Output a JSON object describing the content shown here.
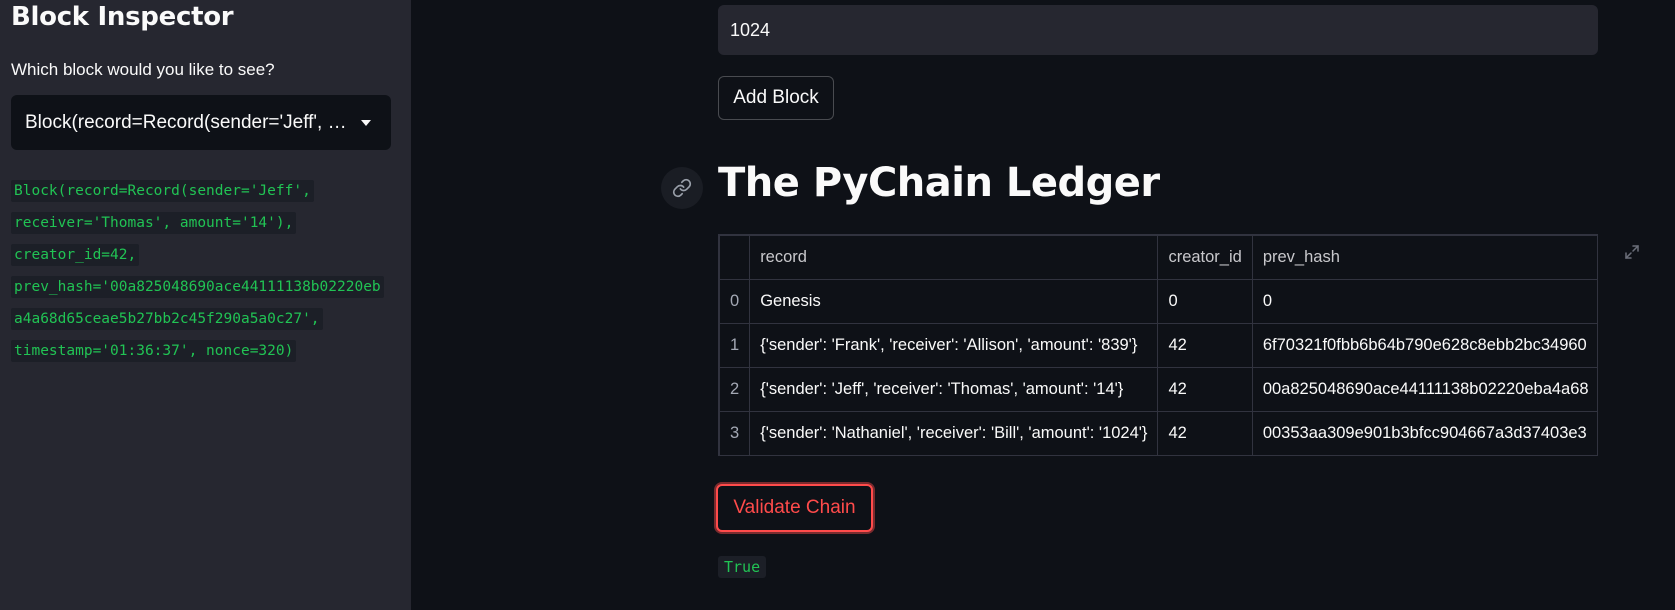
{
  "sidebar": {
    "title": "Block Inspector",
    "question": "Which block would you like to see?",
    "selected_block": "Block(record=Record(sender='Jeff', receiver='Thomas', amount='14'), creator_id=42, prev_hash=...",
    "selected_display": "Block(record=Record(sender='Jeff', …",
    "block_detail_lines": [
      "Block(record=Record(sender='Jeff',",
      "receiver='Thomas', amount='14'),",
      "creator_id=42,",
      "prev_hash='00a825048690ace44111138b02220eb",
      "a4a68d65ceae5b27bb2c45f290a5a0c27',",
      "timestamp='01:36:37', nonce=320)"
    ]
  },
  "main": {
    "amount_input_value": "1024",
    "add_block_label": "Add Block",
    "ledger_title": "The PyChain Ledger",
    "table": {
      "columns": [
        "",
        "record",
        "creator_id",
        "prev_hash"
      ],
      "rows": [
        {
          "index": "0",
          "record": "Genesis",
          "creator_id": "0",
          "prev_hash": "0"
        },
        {
          "index": "1",
          "record": "{'sender': 'Frank', 'receiver': 'Allison', 'amount': '839'}",
          "creator_id": "42",
          "prev_hash": "6f70321f0fbb6b64b790e628c8ebb2bc34960"
        },
        {
          "index": "2",
          "record": "{'sender': 'Jeff', 'receiver': 'Thomas', 'amount': '14'}",
          "creator_id": "42",
          "prev_hash": "00a825048690ace44111138b02220eba4a68"
        },
        {
          "index": "3",
          "record": "{'sender': 'Nathaniel', 'receiver': 'Bill', 'amount': '1024'}",
          "creator_id": "42",
          "prev_hash": "00353aa309e901b3bfcc904667a3d37403e3"
        }
      ]
    },
    "validate_label": "Validate Chain",
    "validate_result": "True"
  },
  "colors": {
    "background": "#0e1117",
    "sidebar": "#262730",
    "code_green": "#21c354",
    "accent_red": "#ff4b4b"
  }
}
